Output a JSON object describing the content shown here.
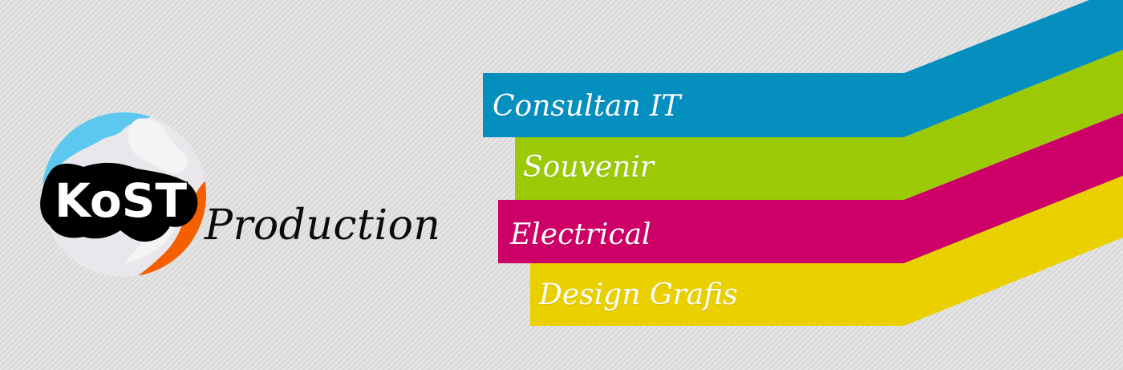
{
  "brand": {
    "logo_text": "KoST",
    "tagline": "Production"
  },
  "services": [
    {
      "label": "Consultan IT",
      "color": "#058fbf"
    },
    {
      "label": "Souvenir",
      "color": "#9cca06"
    },
    {
      "label": "Electrical",
      "color": "#cc0066"
    },
    {
      "label": "Design Grafis",
      "color": "#ebd000"
    }
  ],
  "logo_colors": {
    "blue": "#5cc8ef",
    "orange": "#f45f00",
    "light": "#e9e7ec",
    "black": "#000000"
  }
}
